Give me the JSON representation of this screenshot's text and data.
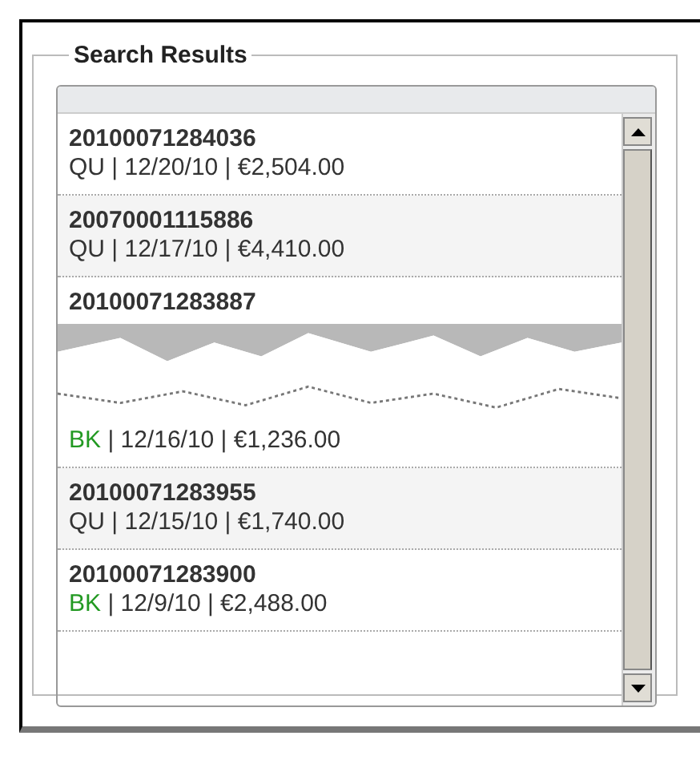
{
  "group": {
    "title": "Search Results"
  },
  "rows": [
    {
      "id": "20100071284036",
      "status": "QU",
      "color": "#333333",
      "details": "| 12/20/10 | €2,504.00",
      "torn": false
    },
    {
      "id": "20070001115886",
      "status": "QU",
      "color": "#333333",
      "details": "| 12/17/10 | €4,410.00",
      "torn": false
    },
    {
      "id": "20100071283887",
      "status": "BK",
      "color": "#229922",
      "details": "| 12/16/10 | €1,236.00",
      "torn": true
    },
    {
      "id": "20100071283955",
      "status": "QU",
      "color": "#333333",
      "details": "| 12/15/10 | €1,740.00",
      "torn": false
    },
    {
      "id": "20100071283900",
      "status": "BK",
      "color": "#229922",
      "details": "| 12/9/10 | €2,488.00",
      "torn": false
    }
  ]
}
